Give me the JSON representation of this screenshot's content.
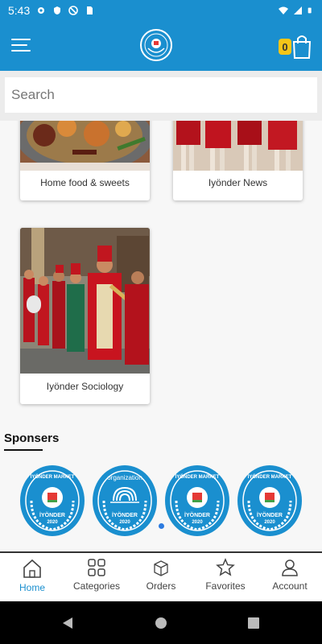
{
  "status_bar": {
    "time": "5:43"
  },
  "search": {
    "placeholder": "Search"
  },
  "cart": {
    "count": "0"
  },
  "categories": [
    {
      "label": "Home food & sweets"
    },
    {
      "label": "Iyönder News"
    },
    {
      "label": "Iyönder Sociology"
    }
  ],
  "sponsors": {
    "title": "Sponsers",
    "items": [
      {
        "top_text": "İYÖNDER MARKET",
        "bottom_text": "İYÖNDER",
        "year": "2020"
      },
      {
        "top_text": "organization",
        "bottom_text": "İYÖNDER",
        "year": "2020"
      },
      {
        "top_text": "İYÖNDER MARKET",
        "bottom_text": "İYÖNDER",
        "year": "2020"
      },
      {
        "top_text": "İYÖNDER MARKET",
        "bottom_text": "İYÖNDER",
        "year": "2020"
      }
    ]
  },
  "bottom_nav": {
    "items": [
      {
        "label": "Home",
        "icon": "home-icon"
      },
      {
        "label": "Categories",
        "icon": "grid-icon"
      },
      {
        "label": "Orders",
        "icon": "box-icon"
      },
      {
        "label": "Favorites",
        "icon": "star-icon"
      },
      {
        "label": "Account",
        "icon": "user-icon"
      }
    ]
  },
  "colors": {
    "primary": "#1a8fcf",
    "badge": "#f5c518",
    "dot": "#2d7be0"
  }
}
